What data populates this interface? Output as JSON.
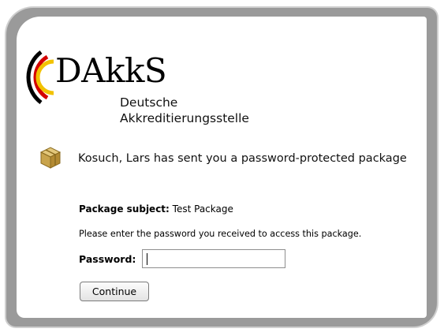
{
  "brand": {
    "name": "DAkkS",
    "line1": "Deutsche",
    "line2": "Akkreditierungsstelle",
    "colors": {
      "black": "#000000",
      "red": "#d40000",
      "gold": "#f2c200"
    }
  },
  "message": {
    "icon": "package-box-icon",
    "headline": "Kosuch, Lars has sent you a password-protected package"
  },
  "package": {
    "subject_label": "Package subject:",
    "subject_value": "Test Package"
  },
  "form": {
    "instructions": "Please enter the password you received to access this package.",
    "password_label": "Password:",
    "password_value": "",
    "continue_label": "Continue"
  }
}
